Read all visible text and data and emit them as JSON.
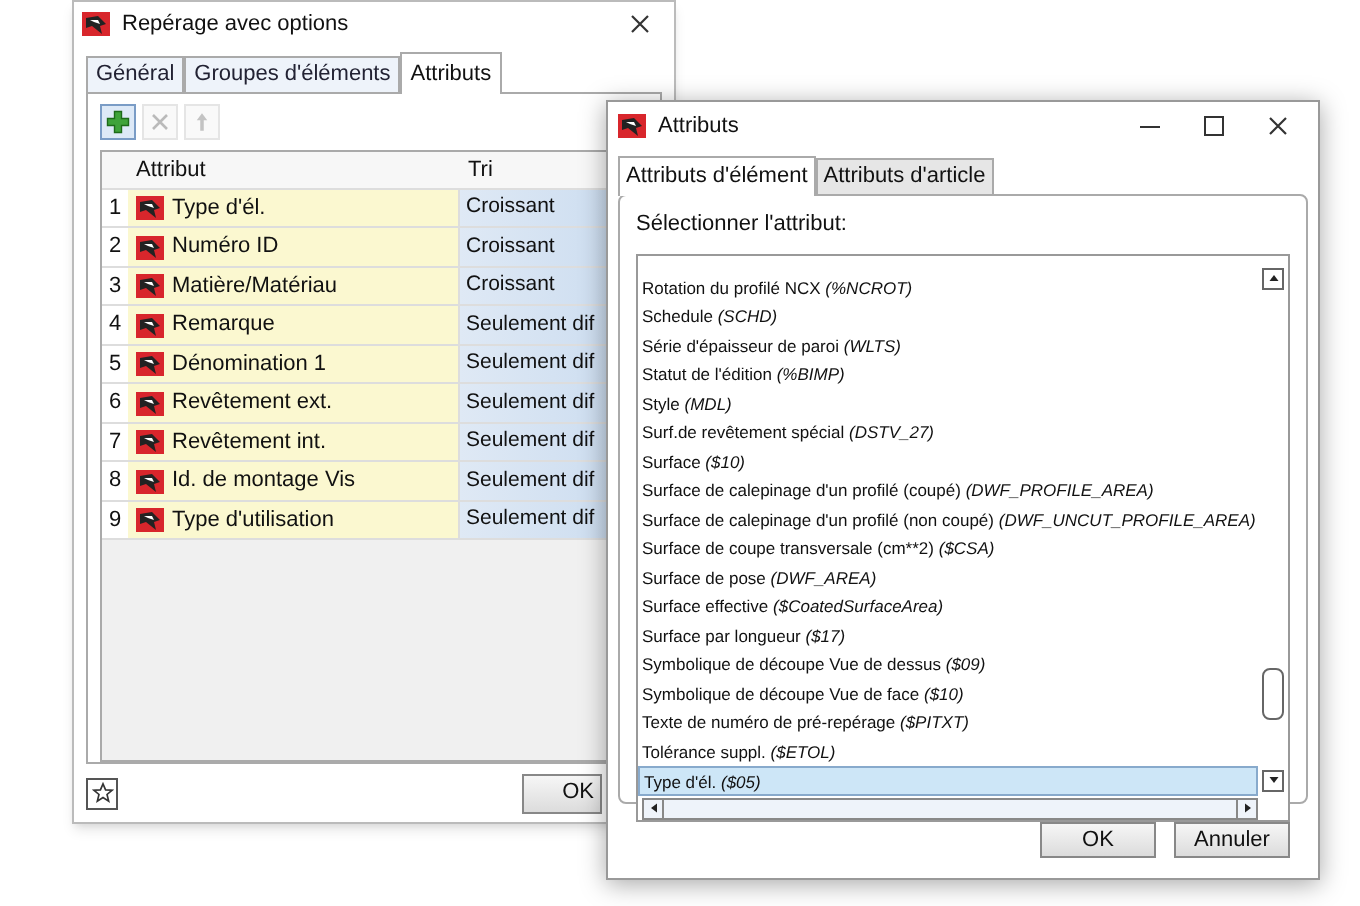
{
  "back_dialog": {
    "title": "Repérage avec options",
    "tabs": [
      {
        "label": "Général",
        "selected": false
      },
      {
        "label": "Groupes d'éléments",
        "selected": false
      },
      {
        "label": "Attributs",
        "selected": true
      }
    ],
    "toolbar": [
      {
        "kind": "add",
        "disabled": false
      },
      {
        "kind": "delete",
        "disabled": true
      },
      {
        "kind": "up",
        "disabled": true
      }
    ],
    "table": {
      "columns": [
        "Attribut",
        "Tri"
      ],
      "rows": [
        {
          "number": "1",
          "attribut": "Type d'él.",
          "tri": "Croissant"
        },
        {
          "number": "2",
          "attribut": "Numéro ID",
          "tri": "Croissant"
        },
        {
          "number": "3",
          "attribut": "Matière/Matériau",
          "tri": "Croissant"
        },
        {
          "number": "4",
          "attribut": "Remarque",
          "tri": "Seulement dif"
        },
        {
          "number": "5",
          "attribut": "Dénomination 1",
          "tri": "Seulement dif"
        },
        {
          "number": "6",
          "attribut": "Revêtement ext.",
          "tri": "Seulement dif"
        },
        {
          "number": "7",
          "attribut": "Revêtement int.",
          "tri": "Seulement dif"
        },
        {
          "number": "8",
          "attribut": "Id. de montage Vis",
          "tri": "Seulement dif"
        },
        {
          "number": "9",
          "attribut": "Type d'utilisation",
          "tri": "Seulement dif"
        }
      ]
    },
    "buttons": [
      "OK"
    ]
  },
  "front_dialog": {
    "title": "Attributs",
    "tabs": [
      {
        "label": "Attributs d'élément",
        "selected": true
      },
      {
        "label": "Attributs d'article",
        "selected": false
      }
    ],
    "label": "Sélectionner l'attribut:",
    "items": [
      {
        "text": "Rotation du profilé NCX *(%NCROT)*",
        "selected": false
      },
      {
        "text": "Schedule *(SCHD)*",
        "selected": false
      },
      {
        "text": "Série d'épaisseur de paroi *(WLTS)*",
        "selected": false
      },
      {
        "text": "Statut de l'édition *(%BIMP)*",
        "selected": false
      },
      {
        "text": "Style *(MDL)*",
        "selected": false
      },
      {
        "text": "Surf.de revêtement spécial *(DSTV_27)*",
        "selected": false
      },
      {
        "text": "Surface *($10)*",
        "selected": false
      },
      {
        "text": "Surface de calepinage d'un profilé (coupé) *(DWF_PROFILE_AREA)*",
        "selected": false
      },
      {
        "text": "Surface de calepinage d'un profilé (non coupé) *(DWF_UNCUT_PROFILE_AREA)*",
        "selected": false
      },
      {
        "text": "Surface de coupe transversale (cm**2) *($CSA)*",
        "selected": false
      },
      {
        "text": "Surface de pose *(DWF_AREA)*",
        "selected": false
      },
      {
        "text": "Surface effective *($CoatedSurfaceArea)*",
        "selected": false
      },
      {
        "text": "Surface par longueur *($17)*",
        "selected": false
      },
      {
        "text": "Symbolique de découpe Vue de dessus *($09)*",
        "selected": false
      },
      {
        "text": "Symbolique de découpe Vue de face *($10)*",
        "selected": false
      },
      {
        "text": "Texte de numéro de pré-repérage *($PITXT)*",
        "selected": false
      },
      {
        "text": "Tolérance suppl. *($ETOL)*",
        "selected": false
      },
      {
        "text": "Type d'él. *($05)*",
        "selected": true
      }
    ],
    "buttons": [
      "OK",
      "Annuler"
    ]
  }
}
